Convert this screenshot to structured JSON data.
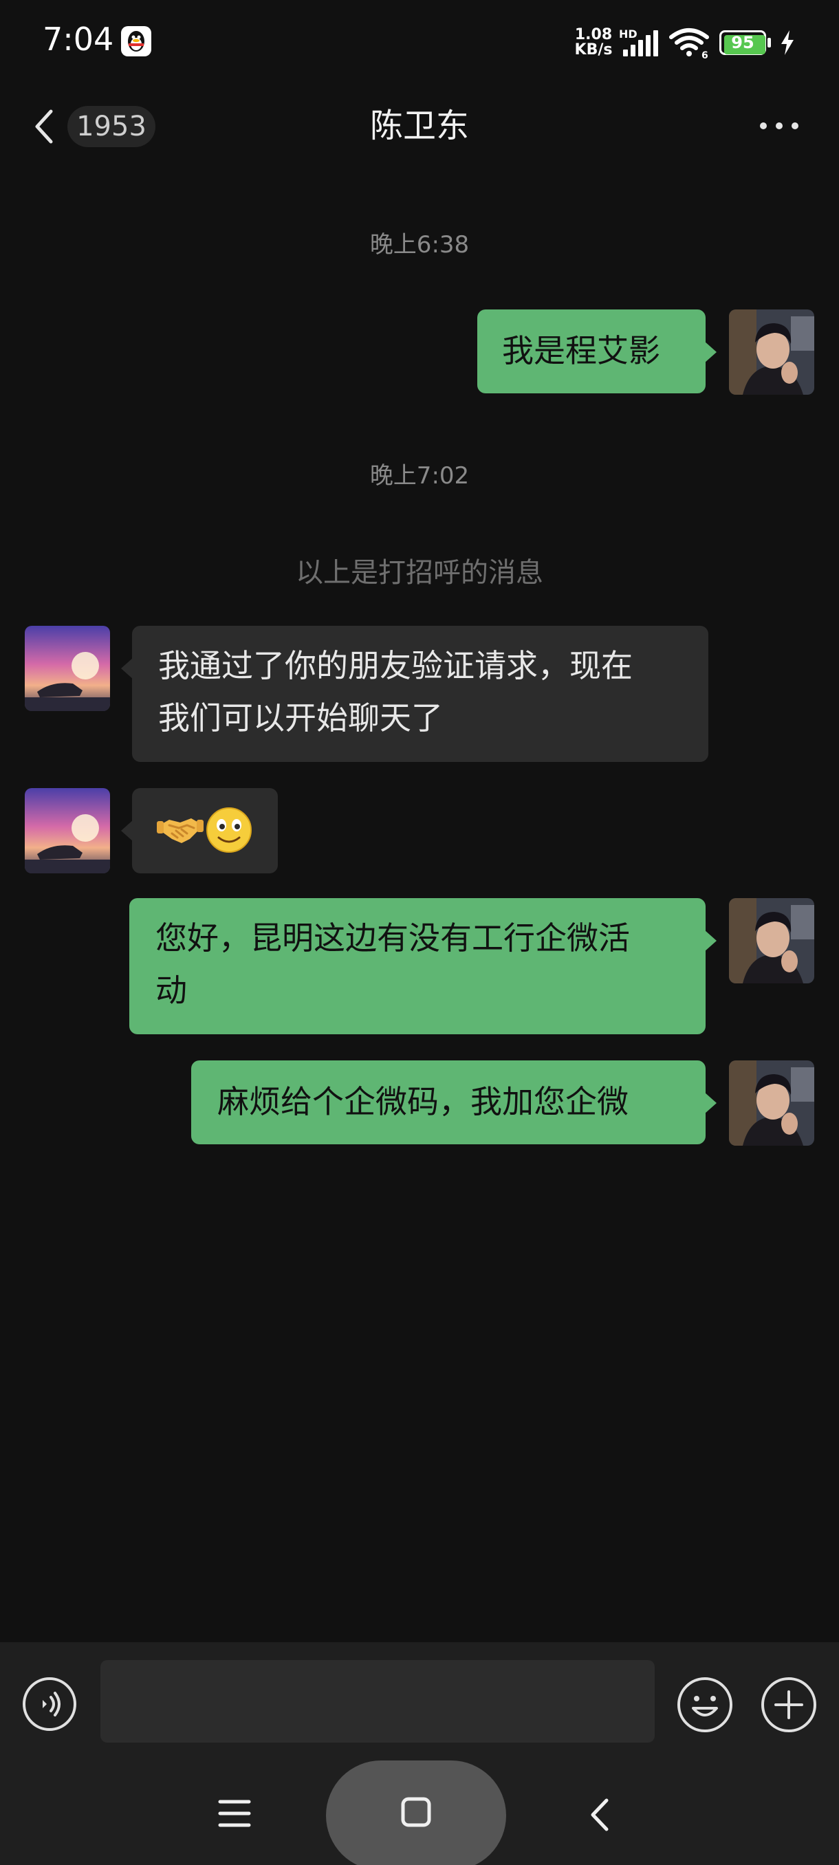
{
  "status_bar": {
    "time": "7:04",
    "net_speed_value": "1.08",
    "net_speed_unit": "KB/s",
    "hd_label": "HD",
    "battery": "95",
    "icons": [
      "qq-penguin-icon",
      "signal-icon",
      "wifi-icon",
      "battery-icon",
      "charging-icon"
    ]
  },
  "header": {
    "back_icon": "chevron-left-icon",
    "unread_count": "1953",
    "title": "陈卫东",
    "more_icon": "more-dots-icon"
  },
  "messages": [
    {
      "kind": "time",
      "text": "晚上6:38"
    },
    {
      "kind": "bubble",
      "direction": "out",
      "text": "我是程艾影"
    },
    {
      "kind": "time",
      "text": "晚上7:02"
    },
    {
      "kind": "system",
      "text": "以上是打招呼的消息"
    },
    {
      "kind": "bubble",
      "direction": "in",
      "line1": "我通过了你的朋友验证请求，现在",
      "line2": "我们可以开始聊天了"
    },
    {
      "kind": "bubble",
      "direction": "in",
      "emoji_icons": [
        "handshake-emoji",
        "smile-emoji"
      ]
    },
    {
      "kind": "bubble",
      "direction": "out",
      "line1": "您好，昆明这边有没有工行企微活",
      "line2": "动"
    },
    {
      "kind": "bubble",
      "direction": "out",
      "text": "麻烦给个企微码，我加您企微"
    }
  ],
  "input_bar": {
    "placeholder": "",
    "icons": [
      "voice-icon",
      "emoji-icon",
      "plus-icon"
    ]
  },
  "nav_bar": {
    "icons": [
      "menu-icon",
      "home-icon",
      "back-icon"
    ]
  },
  "colors": {
    "background": "#111111",
    "outgoing_bubble": "#5fb673",
    "incoming_bubble": "#2c2c2c",
    "battery_fill": "#57c750"
  }
}
